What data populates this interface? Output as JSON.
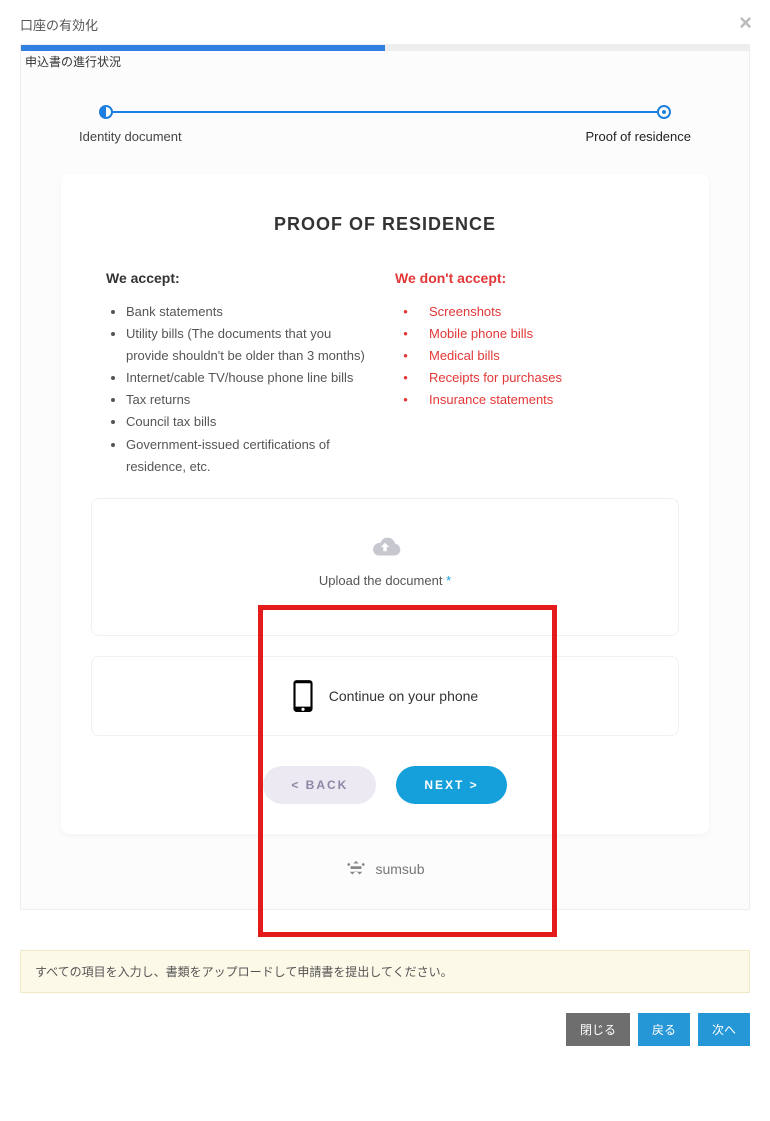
{
  "modal": {
    "title": "口座の有効化",
    "sub_title": "申込書の進行状況"
  },
  "steps": {
    "left_label": "Identity document",
    "right_label": "Proof of residence"
  },
  "por": {
    "title": "PROOF OF RESIDENCE",
    "accept_header": "We accept:",
    "accept_items": [
      "Bank statements",
      "Utility bills (The documents that you provide shouldn't be older than 3 months)",
      "Internet/cable TV/house phone line bills",
      "Tax returns",
      "Council tax bills",
      "Government-issued certifications of residence, etc."
    ],
    "reject_header": "We don't accept:",
    "reject_items": [
      "Screenshots",
      "Mobile phone bills",
      "Medical bills",
      "Receipts for purchases",
      "Insurance statements"
    ]
  },
  "upload": {
    "label": "Upload the document ",
    "required_mark": "*"
  },
  "phone": {
    "label": "Continue on your phone"
  },
  "buttons": {
    "back": "<    BACK",
    "next": "NEXT    >"
  },
  "logo": {
    "text": "sumsub"
  },
  "banner": {
    "text": "すべての項目を入力し、書類をアップロードして申請書を提出してください。"
  },
  "footer": {
    "close": "閉じる",
    "back": "戻る",
    "next": "次へ"
  }
}
